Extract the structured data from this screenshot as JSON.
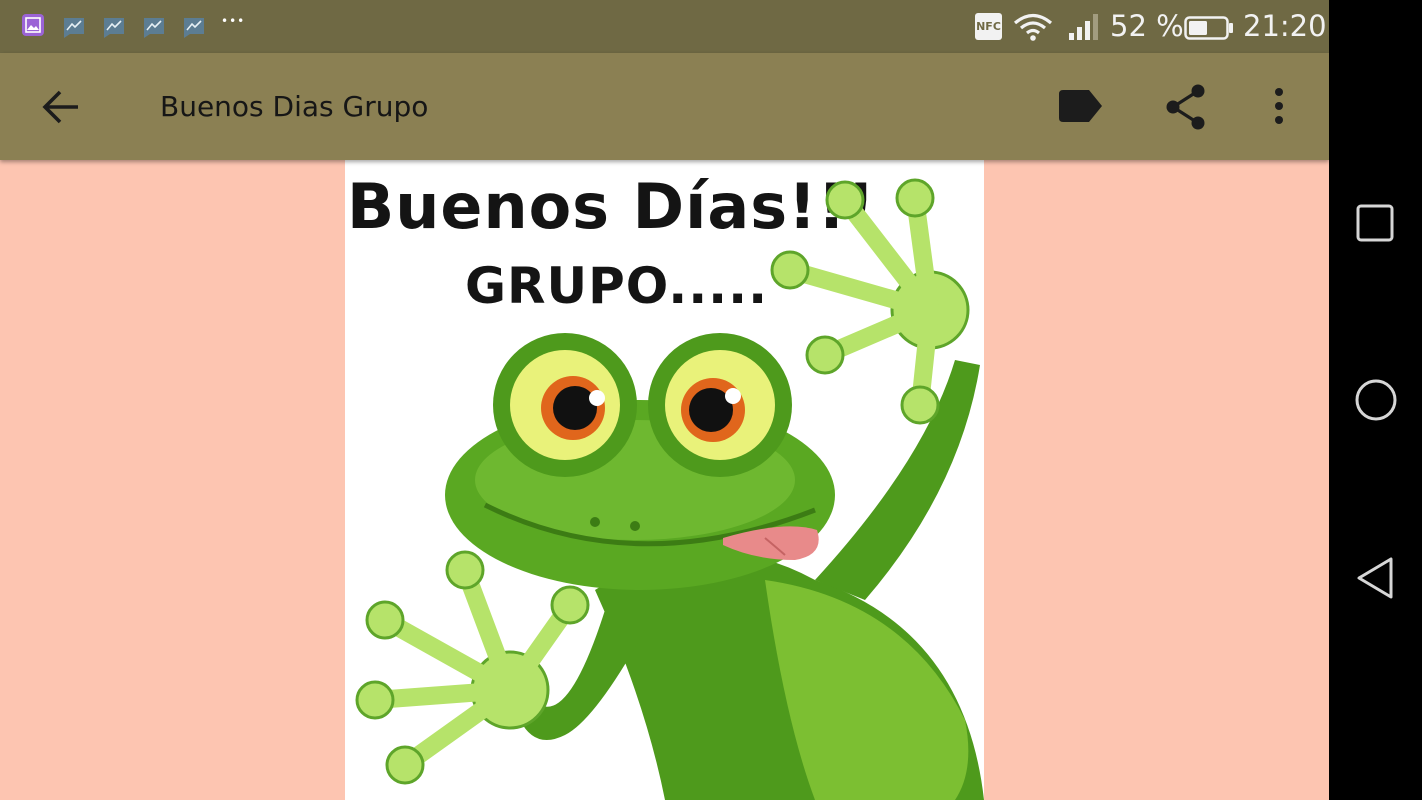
{
  "status_bar": {
    "battery_percent": "52 %",
    "time": "21:20",
    "nfc_label": "NFC",
    "overflow_dots": "•••",
    "notification_icons": [
      "gallery-icon",
      "chart-icon",
      "chart-icon",
      "chart-icon",
      "chart-icon"
    ],
    "battery_level": 0.52
  },
  "app_bar": {
    "title": "Buenos Dias Grupo",
    "actions": [
      "label-icon",
      "share-icon",
      "more-vert-icon"
    ]
  },
  "image": {
    "headline": "Buenos Días!!!",
    "subline": "GRUPO....."
  },
  "nav_bar": {
    "buttons": [
      "recents-icon",
      "home-icon",
      "back-icon"
    ]
  },
  "colors": {
    "status_bar": "#6f6944",
    "app_bar": "#8b8053",
    "background": "#fdc5b1",
    "frog_green": "#4e9a1c",
    "frog_light": "#b6e36a"
  }
}
